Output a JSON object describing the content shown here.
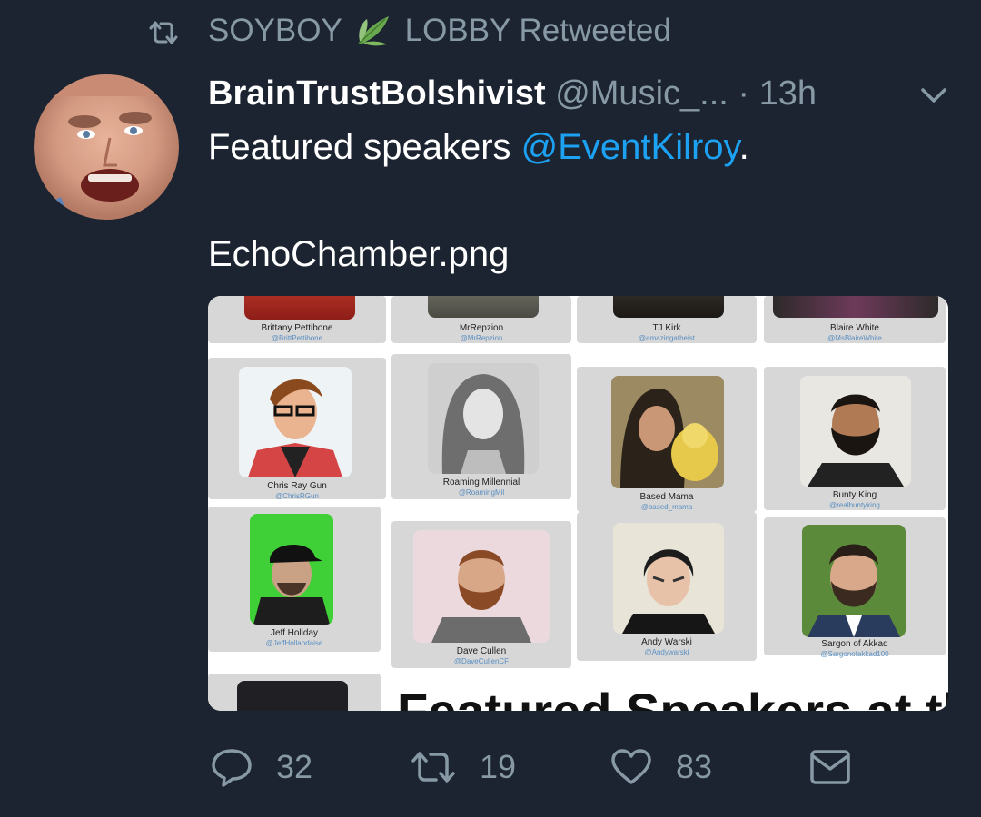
{
  "retweet_bar": {
    "prefix": "SOYBOY",
    "suffix": "LOBBY Retweeted",
    "icon": "retweet-icon"
  },
  "tweet": {
    "display_name": "BrainTrustBolshivist",
    "handle": "@Music_...",
    "separator": "·",
    "time": "13h",
    "text_before": "Featured speakers ",
    "mention": "@EventKilroy",
    "text_after": ".",
    "file_line": "EchoChamber.png"
  },
  "media": {
    "speakers": [
      {
        "name": "Brittany Pettibone",
        "handle": "@BrittPettibone"
      },
      {
        "name": "MrRepzion",
        "handle": "@MrRepzion"
      },
      {
        "name": "TJ Kirk",
        "handle": "@amazingatheist"
      },
      {
        "name": "Blaire White",
        "handle": "@MsBlaireWhite"
      },
      {
        "name": "Chris Ray Gun",
        "handle": "@ChrisRGun"
      },
      {
        "name": "Roaming Millennial",
        "handle": "@RoamingMil"
      },
      {
        "name": "Based Mama",
        "handle": "@based_mama"
      },
      {
        "name": "Bunty King",
        "handle": "@realbuntyking"
      },
      {
        "name": "Jeff Holiday",
        "handle": "@JeffHollandaise"
      },
      {
        "name": "Dave Cullen",
        "handle": "@DaveCullenCF"
      },
      {
        "name": "Andy Warski",
        "handle": "@Andywarski"
      },
      {
        "name": "Sargon of Akkad",
        "handle": "@Sargonofakkad100"
      }
    ],
    "bottom_heading": "Featured Speakers at the"
  },
  "actions": {
    "reply_count": "32",
    "retweet_count": "19",
    "like_count": "83"
  },
  "colors": {
    "background": "#1b2430",
    "muted": "#8899a6",
    "link": "#1da1f2"
  }
}
